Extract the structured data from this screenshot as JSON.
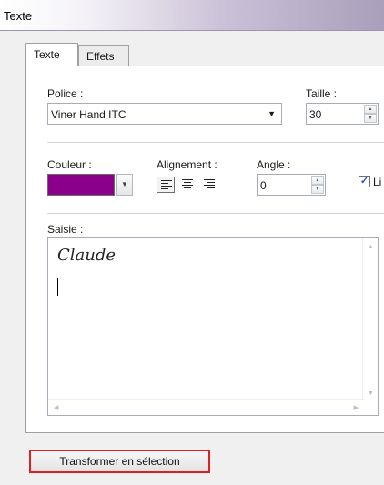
{
  "window": {
    "title": "Texte"
  },
  "tabs": [
    {
      "label": "Texte",
      "active": true
    },
    {
      "label": "Effets",
      "active": false
    }
  ],
  "font": {
    "label": "Police :",
    "value": "Viner Hand ITC"
  },
  "size": {
    "label": "Taille :",
    "value": "30"
  },
  "color": {
    "label": "Couleur :",
    "value": "#8b008b"
  },
  "alignment": {
    "label": "Alignement :",
    "options": [
      "left",
      "center",
      "right"
    ],
    "selected": "left"
  },
  "angle": {
    "label": "Angle :",
    "value": "0"
  },
  "checkbox": {
    "label": "Li",
    "checked": true
  },
  "entry": {
    "label": "Saisie :",
    "value": "Claude"
  },
  "footer": {
    "transform_button": "Transformer en sélection",
    "highlight_color": "#e02020"
  }
}
